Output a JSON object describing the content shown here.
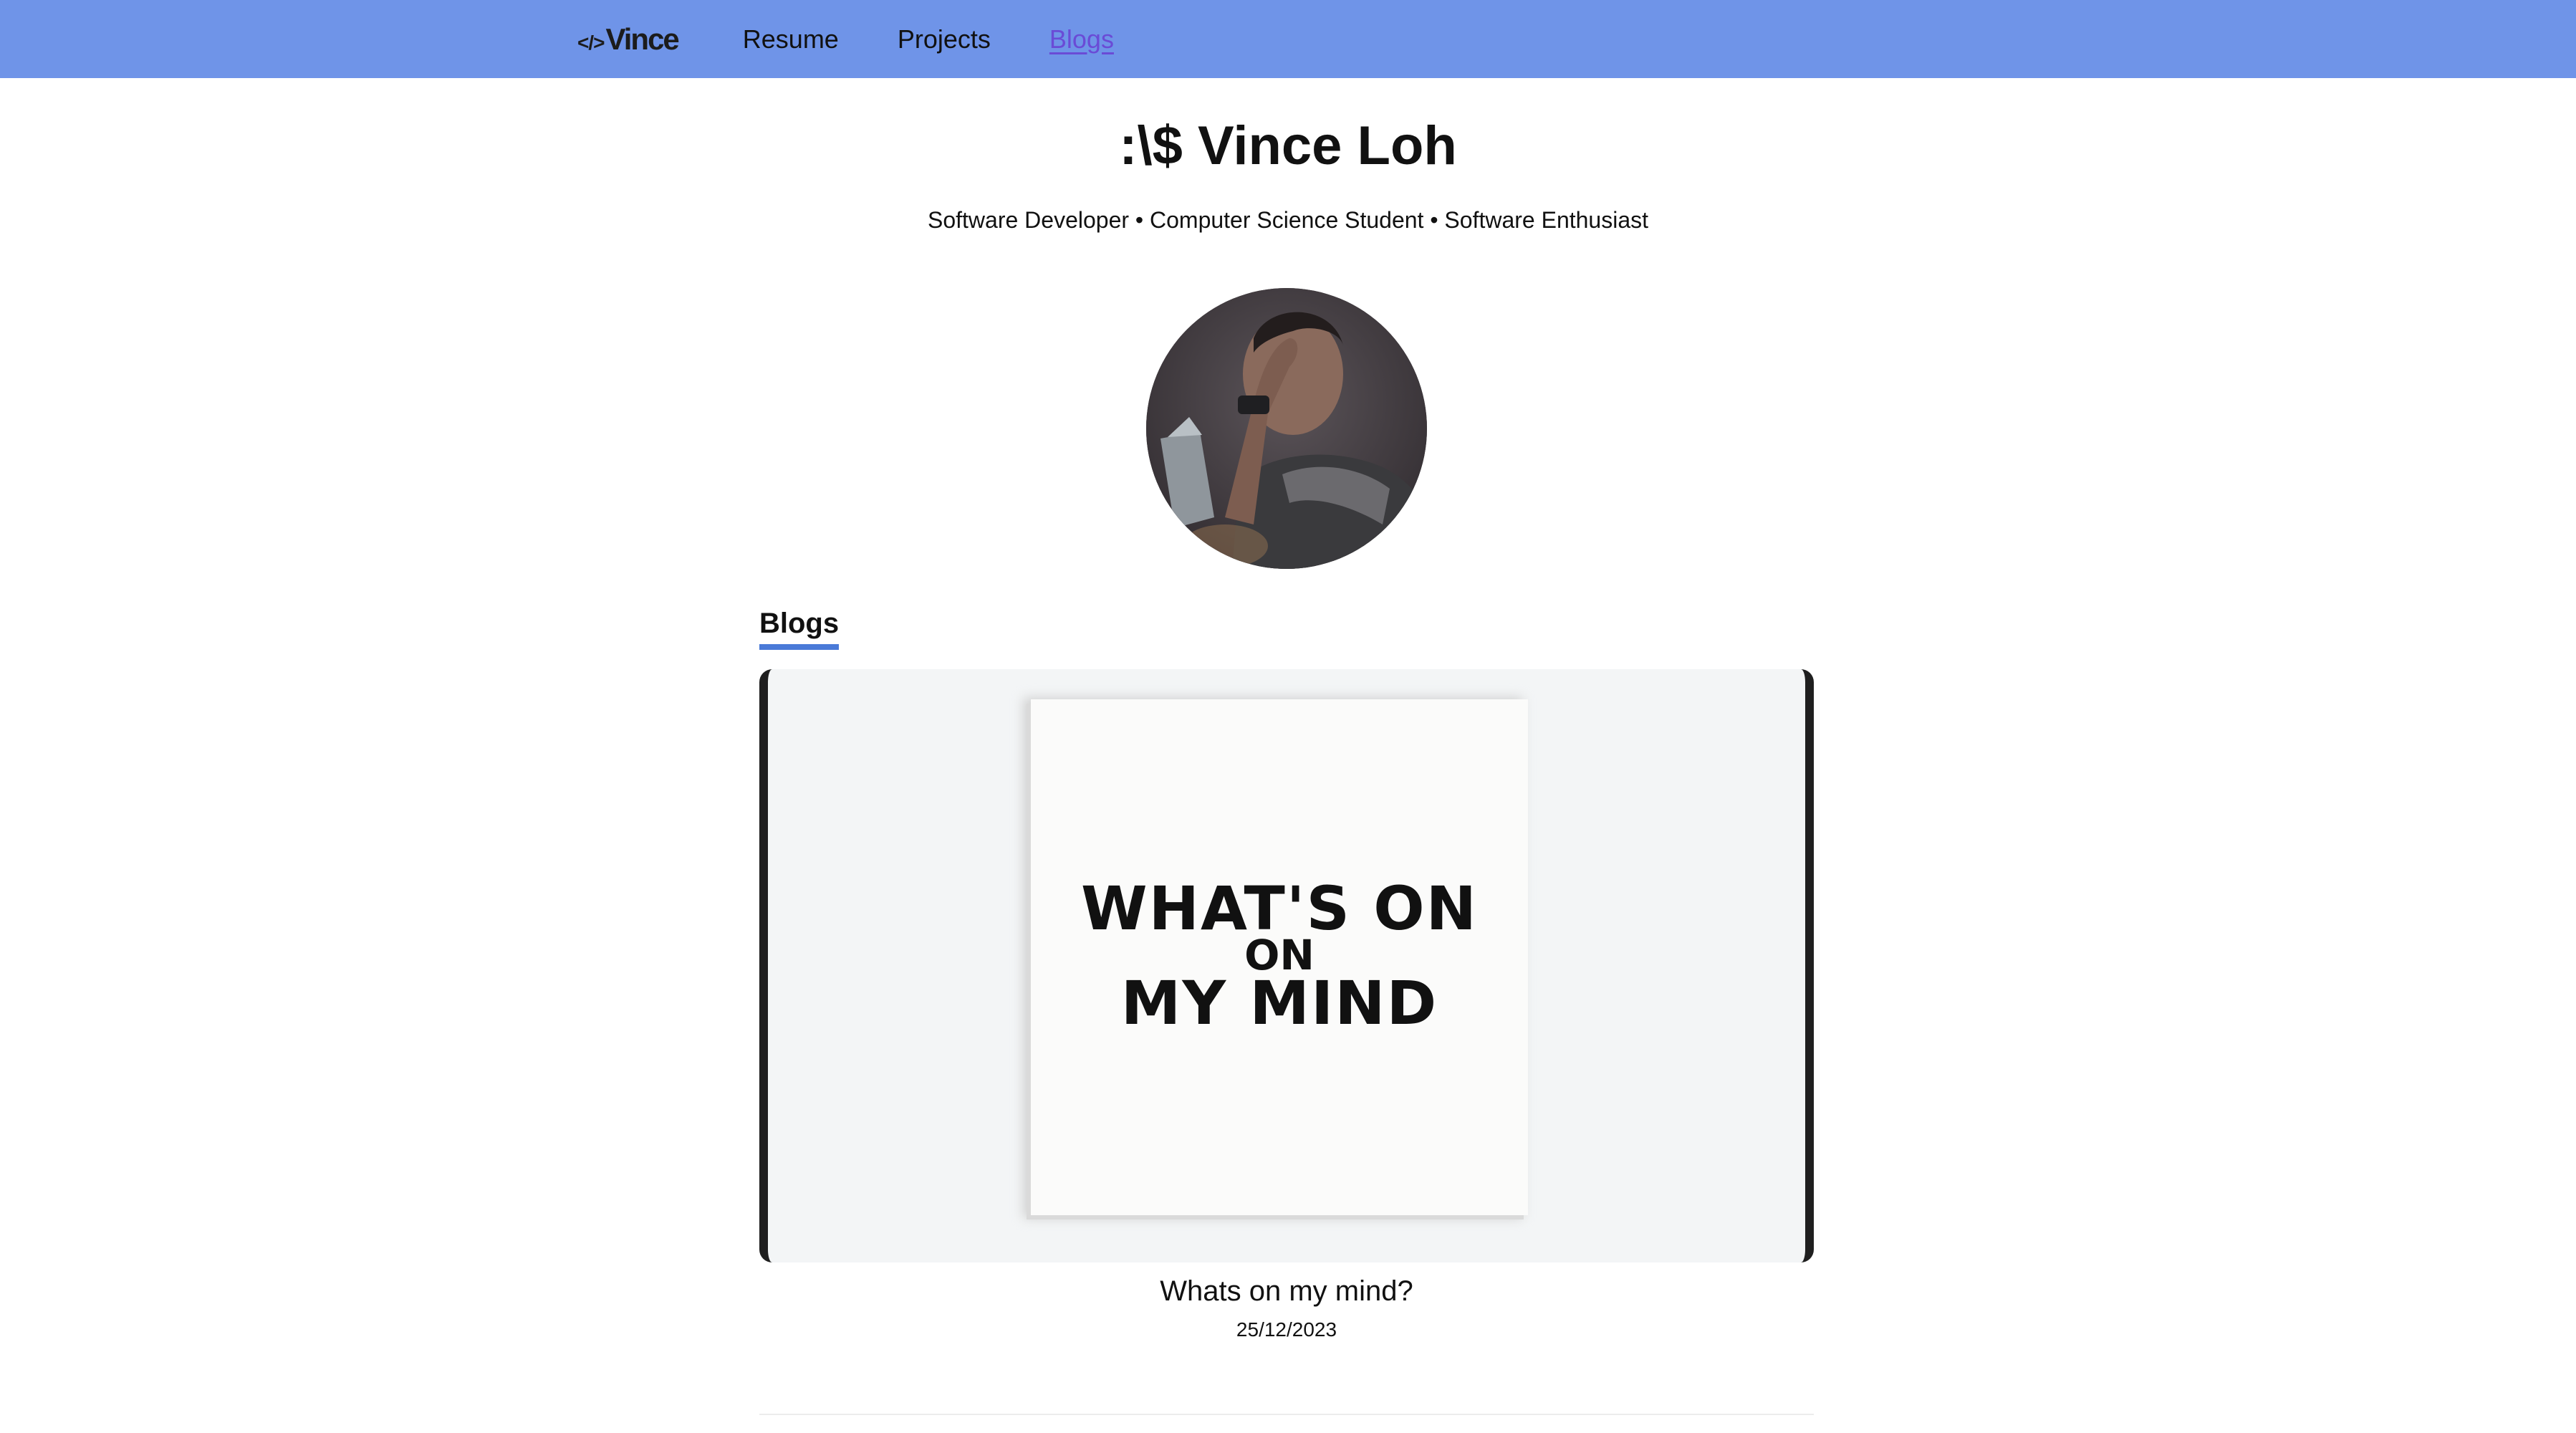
{
  "nav": {
    "brand_mark": "</>",
    "brand_name": "Vince",
    "links": [
      {
        "label": "Resume"
      },
      {
        "label": "Projects"
      },
      {
        "label": "Blogs",
        "active": true
      }
    ],
    "background_color": "#6f94e8",
    "active_color": "#6a4bd6"
  },
  "header": {
    "title": ":\\$ Vince Loh",
    "tagline": "Software Developer • Computer Science Student • Software Enthusiast"
  },
  "avatar": {
    "icon": "profile-photo"
  },
  "blogs_section": {
    "heading": "Blogs",
    "accent_color": "#4a7ad8",
    "posts": [
      {
        "cover_text": [
          "WHAT'S ON",
          "ON",
          "MY MIND"
        ],
        "title": "Whats on my mind?",
        "date": "25/12/2023"
      }
    ]
  }
}
